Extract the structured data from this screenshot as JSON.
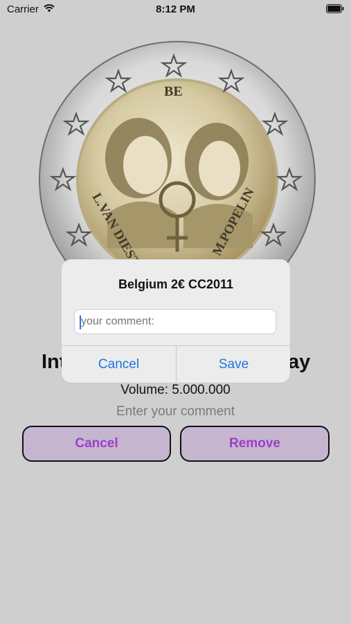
{
  "status_bar": {
    "carrier": "Carrier",
    "time": "8:12 PM"
  },
  "coin": {
    "image_name": "belgium-2-euro-coin-icon",
    "legend_top": "BE",
    "legend_left": "L.VAN DIEST",
    "legend_right": "M.POPELIN"
  },
  "screen": {
    "title_left": "Int",
    "title_right": "ay",
    "volume": "Volume: 5.000.000",
    "comment_placeholder": "Enter your comment",
    "cancel_label": "Cancel",
    "remove_label": "Remove"
  },
  "alert": {
    "title": "Belgium 2€ CC2011",
    "input_placeholder": "your comment:",
    "cancel_label": "Cancel",
    "save_label": "Save"
  },
  "colors": {
    "accent_purple": "#9b3ec6",
    "button_fill": "#c6b5cf",
    "ios_blue": "#1d74e3"
  }
}
